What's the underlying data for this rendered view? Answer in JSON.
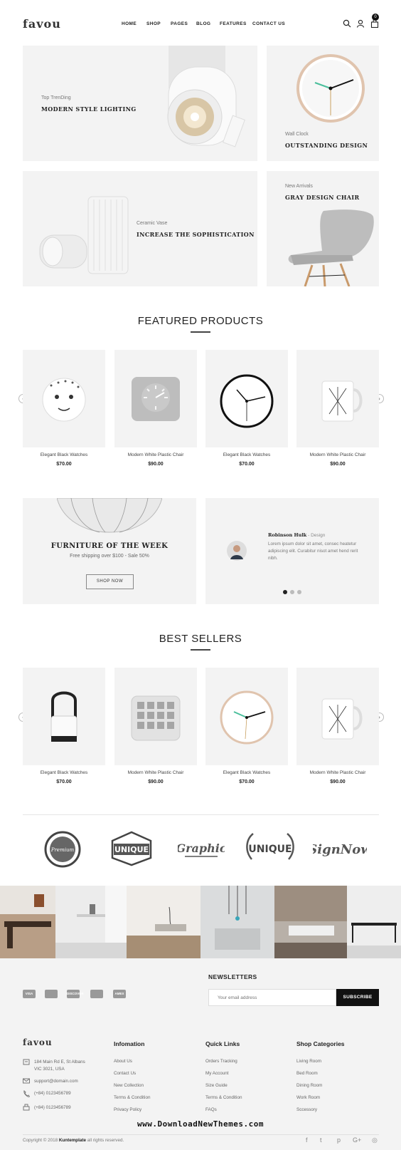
{
  "header": {
    "logo": "favou",
    "nav": [
      "HOME",
      "SHOP",
      "PAGES",
      "BLOG",
      "FEATURES",
      "CONTACT US"
    ],
    "cart_count": "0"
  },
  "hero": [
    {
      "subtitle": "Top TrenDing",
      "title": "MODERN STYLE LIGHTING"
    },
    {
      "subtitle": "Wall Clock",
      "title": "OUTSTANDING DESIGN"
    },
    {
      "subtitle": "Ceramic Vase",
      "title": "INCREASE THE SOPHISTICATION"
    },
    {
      "subtitle": "New Arrivals",
      "title": "GRAY DESIGN CHAIR"
    }
  ],
  "featured": {
    "title": "FEATURED PRODUCTS",
    "products": [
      {
        "name": "Elegant Black Watches",
        "price": "$70.00"
      },
      {
        "name": "Modern White Plastic Chair",
        "price": "$90.00"
      },
      {
        "name": "Elegant Black Watches",
        "price": "$70.00"
      },
      {
        "name": "Modern White Plastic Chair",
        "price": "$90.00"
      }
    ]
  },
  "promo": {
    "title": "FURNITURE OF THE WEEK",
    "subtitle": "Free shipping over $100 - Sale 50%",
    "button": "SHOP NOW"
  },
  "testimonial": {
    "name": "Robinson Hulk",
    "role": "- Design",
    "text": "Lorem ipsum dolor sit amet, consec heatetur adipiscing elit. Curabitur nisot amet hend rerit nibh."
  },
  "bestsellers": {
    "title": "BEST SELLERS",
    "products": [
      {
        "name": "Elegant Black Watches",
        "price": "$70.00"
      },
      {
        "name": "Modern White Plastic Chair",
        "price": "$90.00"
      },
      {
        "name": "Elegant Black Watches",
        "price": "$70.00"
      },
      {
        "name": "Modern White Plastic Chair",
        "price": "$90.00"
      }
    ]
  },
  "brands": [
    "Premium",
    "UNIQUE",
    "Graphic",
    "UNIQUE",
    "SignNow"
  ],
  "footer": {
    "newsletter_title": "NEWSLETTERS",
    "email_placeholder": "Your email address",
    "subscribe": "SUBSCRIBE",
    "payments": [
      "VISA",
      "",
      "DISCOVER",
      "",
      "AMEX"
    ],
    "logo": "favou",
    "address": "184 Main Rd E, St Albans VIC 3021, USA",
    "email": "support@domain.com",
    "phone1": "(+84) 0123456789",
    "phone2": "(+84) 0123456789",
    "info_title": "Infomation",
    "info_links": [
      "About Us",
      "Contact Us",
      "New Collection",
      "Terms & Condition",
      "Privacy Policy"
    ],
    "quick_title": "Quick Links",
    "quick_links": [
      "Orders Tracking",
      "My Account",
      "Size Guide",
      "Terms & Condition",
      "FAQs"
    ],
    "cat_title": "Shop Categories",
    "cat_links": [
      "Living Room",
      "Bed Room",
      "Dining Room",
      "Work Room",
      "Sccessory"
    ],
    "copyright_pre": "Copyright © 2018",
    "copyright_brand": "Kuntemplate",
    "copyright_post": "all rights reserved.",
    "watermark": "www.DownloadNewThemes.com"
  }
}
